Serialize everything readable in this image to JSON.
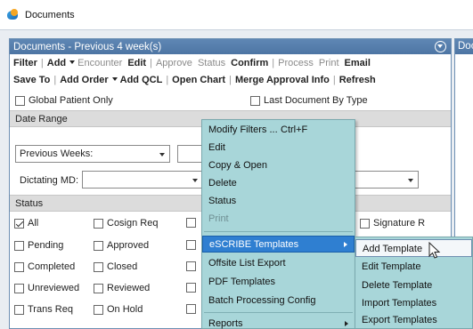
{
  "window": {
    "title": "Documents",
    "icon": "documents-app-icon"
  },
  "panel": {
    "title": "Documents - Previous 4 week(s)",
    "right_panel_title": "Doc"
  },
  "toolbar": {
    "row1": [
      {
        "label": "Filter",
        "disabled": false
      },
      {
        "label": "Add",
        "disabled": false,
        "dropdown": true
      },
      {
        "label": "Encounter",
        "disabled": true
      },
      {
        "label": "Edit",
        "disabled": false
      },
      {
        "label": "Approve",
        "disabled": true
      },
      {
        "label": "Status",
        "disabled": true
      },
      {
        "label": "Confirm",
        "disabled": false
      },
      {
        "label": "Process",
        "disabled": true
      },
      {
        "label": "Print",
        "disabled": true
      },
      {
        "label": "Email",
        "disabled": false
      }
    ],
    "row2": [
      {
        "label": "Save To",
        "dropdown": false
      },
      {
        "label": "Add Order",
        "dropdown": true
      },
      {
        "label": "Add QCL",
        "dropdown": false
      },
      {
        "label": "Open Chart",
        "dropdown": false
      },
      {
        "label": "Merge Approval Info",
        "dropdown": false
      },
      {
        "label": "Refresh",
        "dropdown": false
      }
    ]
  },
  "filters": {
    "global_patient_only": {
      "label": "Global Patient Only",
      "checked": false
    },
    "last_document_by_type": {
      "label": "Last Document By Type",
      "checked": false
    }
  },
  "date_range": {
    "header": "Date Range",
    "selected": "Previous Weeks:",
    "count": ""
  },
  "dictating": {
    "label": "Dictating MD:",
    "value": ""
  },
  "status": {
    "header": "Status",
    "options": [
      {
        "label": "All",
        "checked": true
      },
      {
        "label": "Cosign Req",
        "checked": false
      },
      {
        "label": "Signature R",
        "checked": false
      },
      {
        "label": "Pending",
        "checked": false
      },
      {
        "label": "Approved",
        "checked": false
      },
      {
        "label": "Completed",
        "checked": false
      },
      {
        "label": "Closed",
        "checked": false
      },
      {
        "label": "Unreviewed",
        "checked": false
      },
      {
        "label": "Reviewed",
        "checked": false
      },
      {
        "label": "Trans Req",
        "checked": false
      },
      {
        "label": "On Hold",
        "checked": false
      }
    ]
  },
  "context_menu": {
    "items": [
      {
        "label": "Modify Filters ...",
        "shortcut": "Ctrl+F"
      },
      {
        "label": "Edit"
      },
      {
        "label": "Copy & Open"
      },
      {
        "label": "Delete"
      },
      {
        "label": "Status"
      },
      {
        "label": "Print",
        "disabled": true
      },
      {
        "label": "eSCRIBE Templates",
        "submenu": true,
        "highlight": true
      },
      {
        "label": "Offsite List Export"
      },
      {
        "label": "PDF Templates"
      },
      {
        "label": "Batch Processing Config"
      },
      {
        "label": "Reports",
        "submenu": true
      }
    ]
  },
  "submenu": {
    "items": [
      {
        "label": "Add Template",
        "hover": true
      },
      {
        "label": "Edit Template"
      },
      {
        "label": "Delete Template"
      },
      {
        "label": "Import Templates"
      },
      {
        "label": "Export Templates"
      }
    ]
  },
  "colors": {
    "panel_header": "#5179a8",
    "menu_bg": "#a8d6d9",
    "menu_highlight": "#2f7fd1"
  }
}
